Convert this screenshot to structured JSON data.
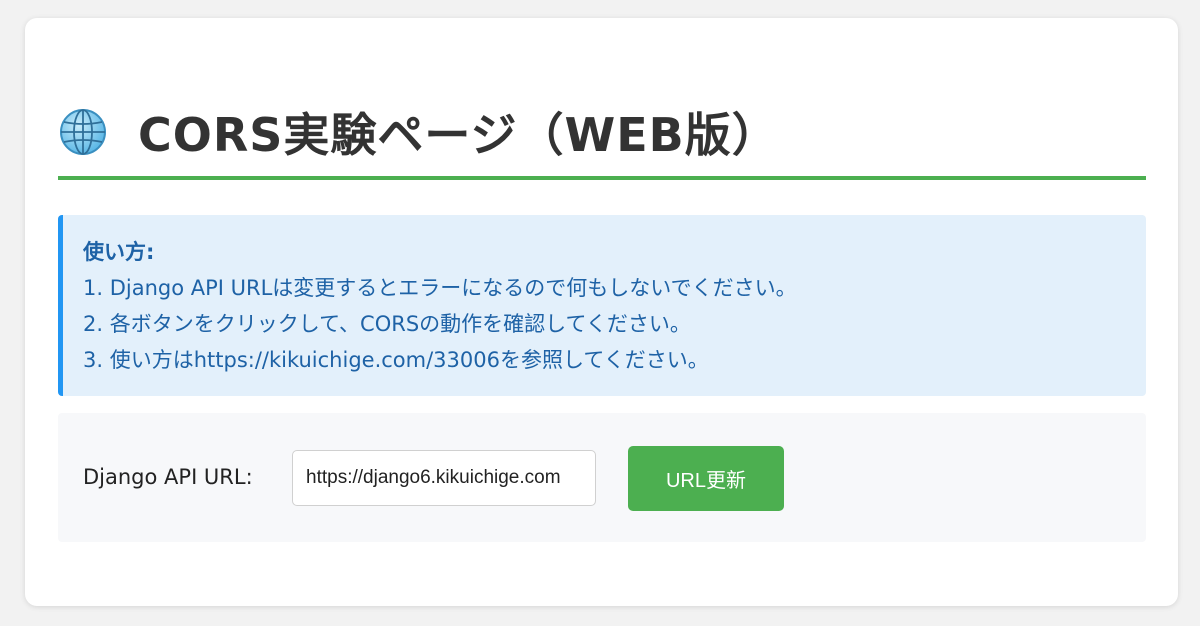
{
  "header": {
    "icon": "globe-icon",
    "title": "CORS実験ページ（WEB版）",
    "accent_color": "#4caf50"
  },
  "instructions": {
    "heading": "使い方:",
    "lines": [
      "1. Django API URLは変更するとエラーになるので何もしないでください。",
      "2. 各ボタンをクリックして、CORSの動作を確認してください。",
      "3. 使い方はhttps://kikuichige.com/33006を参照してください。"
    ],
    "accent_color": "#2196f3",
    "text_color": "#1e62a6"
  },
  "api_url": {
    "label": "Django API URL:",
    "value": "https://django6.kikuichige.com",
    "button_label": "URL更新",
    "button_color": "#4caf50"
  }
}
